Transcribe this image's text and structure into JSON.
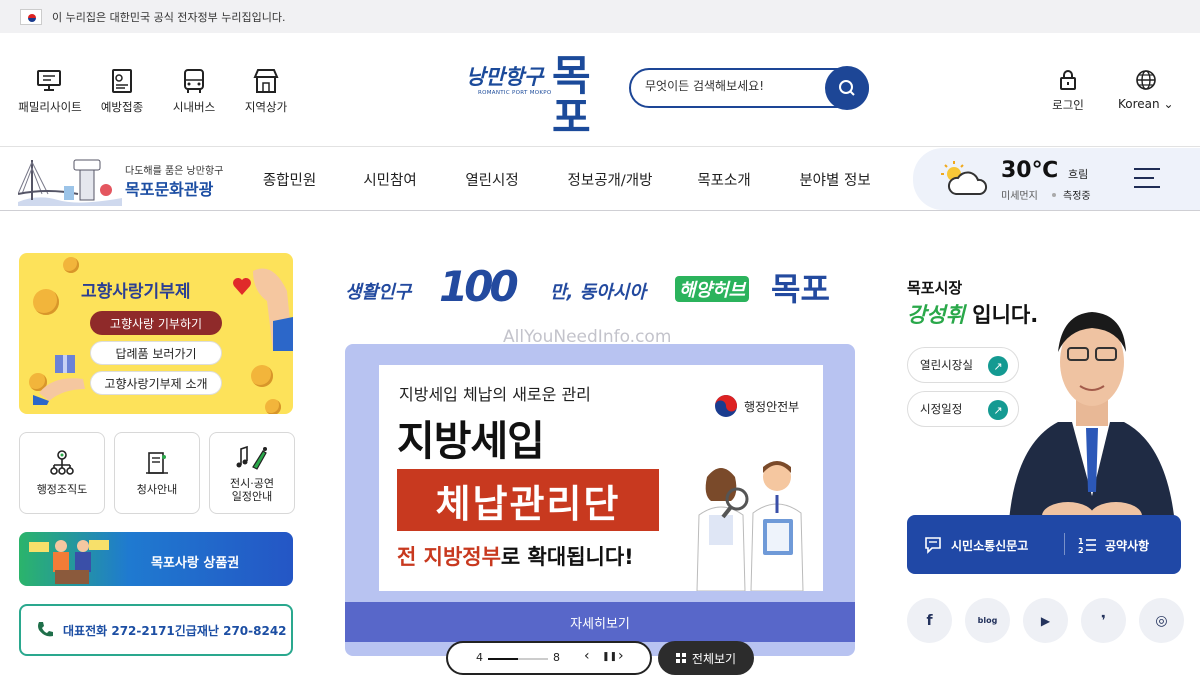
{
  "gov_banner": {
    "text": "이 누리집은 대한민국 공식 전자정부 누리집입니다."
  },
  "quick_links": [
    {
      "label": "패밀리사이트",
      "icon": "monitor-icon"
    },
    {
      "label": "예방접종",
      "icon": "document-icon"
    },
    {
      "label": "시내버스",
      "icon": "bus-icon"
    },
    {
      "label": "지역상가",
      "icon": "shop-icon"
    }
  ],
  "logo": {
    "tagline": "낭만항구",
    "sub": "ROMANTIC PORT MOKPO",
    "name": "목포"
  },
  "search": {
    "placeholder": "무엇이든 검색해보세요!"
  },
  "header_right": {
    "login": "로그인",
    "language": "Korean"
  },
  "tourism": {
    "caption": "다도해를 품은 낭만항구",
    "title": "목포문화관광"
  },
  "nav": {
    "items": [
      "종합민원",
      "시민참여",
      "열린시정",
      "정보공개/개방",
      "목포소개",
      "분야별 정보"
    ]
  },
  "weather": {
    "temp": "30℃",
    "condition": "흐림",
    "dust_label": "미세먼지",
    "dust_value": "측정중"
  },
  "donation": {
    "title": "고향사랑기부제",
    "buttons": [
      "고향사랑 기부하기",
      "답례품 보러가기",
      "고향사랑기부제 소개"
    ]
  },
  "tiles": [
    {
      "label": "행정조직도",
      "icon": "org-chart-icon"
    },
    {
      "label": "청사안내",
      "icon": "building-icon"
    },
    {
      "label": "전시·공연\n일정안내",
      "icon": "music-icon"
    }
  ],
  "voucher": {
    "label": "목포사랑 상품권"
  },
  "contact": {
    "text": "대표전화 272-2171긴급재난 270-8242"
  },
  "slogan": {
    "part1": "생활인구",
    "number": "100",
    "part2": "만, 동아시아",
    "highlight": "해양허브",
    "city": "목포"
  },
  "watermark": "AllYouNeedInfo.com",
  "banner": {
    "line1": "지방세입 체납의 새로운 관리",
    "line2": "지방세입",
    "line3": "체납관리단",
    "line4_highlight": "전 지방정부",
    "line4_rest": "로 확대됩니다!",
    "ministry": "행정안전부",
    "more": "자세히보기"
  },
  "pager": {
    "current": "4",
    "total": "8",
    "progress": 0.5,
    "all_view": "전체보기"
  },
  "mayor": {
    "title": "목포시장",
    "name": "강성휘",
    "suffix": "입니다.",
    "buttons": [
      "열린시장실",
      "시정일정"
    ]
  },
  "communication": {
    "report": "시민소통신문고",
    "pledge": "공약사항"
  },
  "social": [
    {
      "icon": "facebook-icon",
      "glyph": "f"
    },
    {
      "icon": "blog-icon",
      "glyph": "blog"
    },
    {
      "icon": "youtube-icon",
      "glyph": "▶"
    },
    {
      "icon": "kakao-story-icon",
      "glyph": "❜"
    },
    {
      "icon": "instagram-icon",
      "glyph": "◎"
    }
  ],
  "colors": {
    "primary": "#1d4696",
    "accent_green": "#2aa84a",
    "accent_orange": "#f08a1c",
    "banner_red": "#c8391f",
    "teal": "#149a92"
  }
}
